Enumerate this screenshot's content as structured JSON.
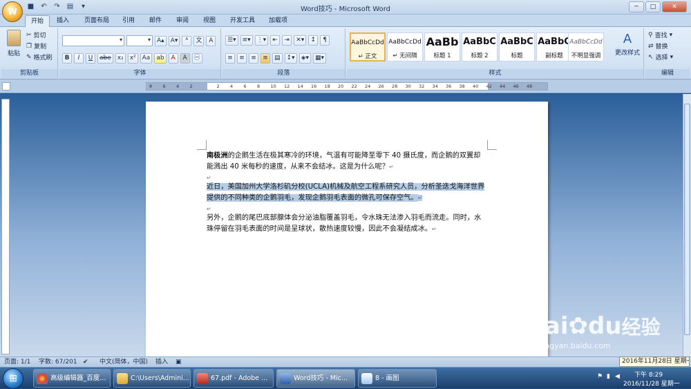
{
  "window": {
    "title": "Word技巧 - Microsoft Word"
  },
  "tabs": [
    "开始",
    "插入",
    "页面布局",
    "引用",
    "邮件",
    "审阅",
    "视图",
    "开发工具",
    "加载项"
  ],
  "clipboard": {
    "paste": "粘贴",
    "cut": "剪切",
    "copy": "复制",
    "format_painter": "格式刷",
    "label": "剪贴板"
  },
  "font": {
    "label": "字体",
    "buttons": [
      "B",
      "I",
      "U",
      "abe",
      "x₂",
      "x²",
      "Aa",
      "A",
      "A"
    ]
  },
  "paragraph": {
    "label": "段落"
  },
  "styles": {
    "label": "样式",
    "items": [
      {
        "sample": "AaBbCcDd",
        "name": "↵ 正文"
      },
      {
        "sample": "AaBbCcDd",
        "name": "↵ 无间隔"
      },
      {
        "sample": "AaBb",
        "name": "标题 1"
      },
      {
        "sample": "AaBbC",
        "name": "标题 2"
      },
      {
        "sample": "AaBbC",
        "name": "标题"
      },
      {
        "sample": "AaBbC",
        "name": "副标题"
      },
      {
        "sample": "AaBbCcDd",
        "name": "不明显强调"
      }
    ],
    "change_styles": "更改样式"
  },
  "editing": {
    "label": "编辑",
    "find": "查找",
    "replace": "替换",
    "select": "选择"
  },
  "ruler": {
    "ticks": [
      "8",
      "6",
      "4",
      "2",
      "",
      "2",
      "4",
      "6",
      "8",
      "10",
      "12",
      "14",
      "16",
      "18",
      "20",
      "22",
      "24",
      "26",
      "28",
      "30",
      "32",
      "34",
      "36",
      "38",
      "40",
      "42",
      "44",
      "46",
      "48"
    ]
  },
  "document": {
    "p1_bold": "南极洲",
    "p1_rest": "的企鹅生活在极其寒冷的环境，气温有可能降至零下 40 摄氏度，而企鹅的双翼却能溅出 40 米每秒的速度，从来不会结冰。这是为什么呢？",
    "p2": "近日，美国加州大学洛杉矶分校(UCLA)机械及航空工程系研究人员，分析圣迭戈海洋世界提供的不同种类的企鹅羽毛，发现企鹅羽毛表面的微孔可保存空气。",
    "p3": "另外，企鹅的尾巴底部腺体会分泌油脂覆盖羽毛，令水珠无法渗入羽毛而流走。同时，水珠停留在羽毛表面的时间是呈球状，散热速度较慢，因此不会凝结成冰。",
    "para_mark": "↵"
  },
  "status": {
    "page": "页面: 1/1",
    "words": "字数: 67/201",
    "lang": "中文(简体，中国)",
    "insert": "插入"
  },
  "taskbar": {
    "items": [
      "高级编辑器_百度...",
      "C:\\Users\\Admini...",
      "67.pdf - Adobe ...",
      "Word技巧 - Mic...",
      "8 - 画图"
    ],
    "time": "下午 8:29",
    "date": "2016/11/28 星期一"
  },
  "tooltip": "2016年11月28日 星期一",
  "watermark": {
    "brand": "Bai",
    "brand2": "du",
    "cn": "经验",
    "url": "jingyan.baidu.com"
  }
}
